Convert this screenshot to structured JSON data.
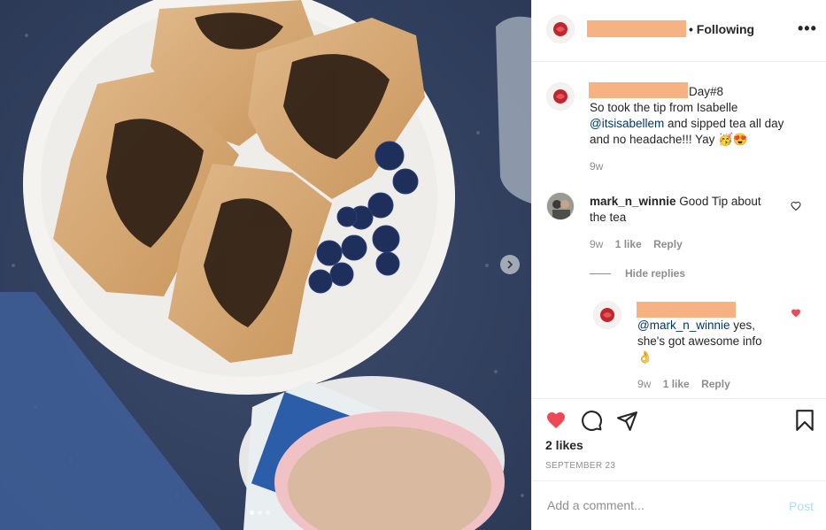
{
  "post": {
    "following_label": "• Following",
    "more_icon": "more-horizontal-icon",
    "photo_alt": "French toast with blueberries and tea",
    "carousel": {
      "count": 3,
      "active": 0
    }
  },
  "caption": {
    "day_tag": "Day#8",
    "line1": "So took the tip from Isabelle",
    "mention": "@itsisabellem",
    "line2_rest": " and sipped tea all day",
    "line3": "and no headache!!! Yay 🥳😍",
    "time": "9w"
  },
  "comments": [
    {
      "username": "mark_n_winnie",
      "text": " Good Tip about",
      "text2": "the tea",
      "time": "9w",
      "likes": "1 like",
      "reply": "Reply",
      "liked": false
    }
  ],
  "hide_replies": "Hide replies",
  "reply": {
    "mention": "@mark_n_winnie",
    "text": " yes,",
    "text2": "she's got awesome info",
    "emoji": "👌",
    "time": "9w",
    "likes": "1 like",
    "reply": "Reply",
    "liked": true
  },
  "likes_label": "2 likes",
  "date_label": "SEPTEMBER 23",
  "comment_box": {
    "placeholder": "Add a comment...",
    "post_label": "Post"
  },
  "colors": {
    "like_red": "#ed4956",
    "link_blue": "#00376b",
    "redaction": "#f7b283",
    "post_disabled": "#b3dbff"
  }
}
